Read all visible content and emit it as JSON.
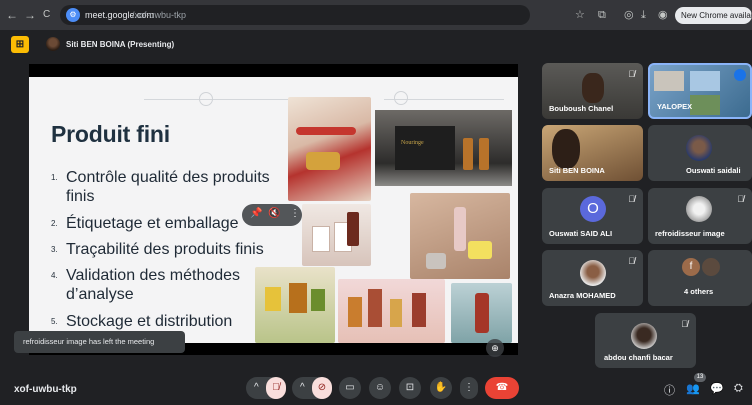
{
  "browser": {
    "back_icon": "←",
    "forward_icon": "→",
    "reload_icon": "C",
    "url_host": "meet.google.com",
    "url_path": "/xof-uwbu-tkp",
    "update_label": "New Chrome available"
  },
  "presenter": {
    "badge_icon": "present-icon",
    "badge_glyph": "⊞",
    "name": "Siti BEN BOINA (Presenting)"
  },
  "slide": {
    "title": "Produit fini",
    "bullets": [
      {
        "num": "1.",
        "text": "Contrôle qualité des produits",
        "cont": "finis"
      },
      {
        "num": "2.",
        "text": "Étiquetage et emballage"
      },
      {
        "num": "3.",
        "text": "Traçabilité des produits finis"
      },
      {
        "num": "4.",
        "text": "Validation des méthodes",
        "cont": "d’analyse"
      },
      {
        "num": "5.",
        "text": "Stockage et distribution"
      }
    ],
    "product_box_label": "Nouringe"
  },
  "participants": [
    {
      "name": "Bouboush Chanel",
      "muted": true
    },
    {
      "name": "YALOPEX",
      "muted": false
    },
    {
      "name": "Siti BEN BOINA",
      "muted": false
    },
    {
      "name": "Ouswati saidali",
      "muted": false
    },
    {
      "name": "Ouswati SAID ALI",
      "muted": true,
      "initial": "O"
    },
    {
      "name": "refroidisseur image",
      "muted": true
    },
    {
      "name": "Anazra MOHAMED",
      "muted": true
    },
    {
      "name": "4 others",
      "muted": false,
      "initial": "f"
    },
    {
      "name": "abdou chanfi bacar",
      "muted": true
    }
  ],
  "toast": {
    "text": "refroidisseur image has left the meeting"
  },
  "footer": {
    "meeting_code": "xof-uwbu-tkp",
    "people_count": "13"
  },
  "colors": {
    "background": "#202124",
    "tile": "#3c4043",
    "end_call": "#ea4335",
    "mic_off": "#f9dedc",
    "present_badge": "#fbbc04",
    "avatar_blue": "#5b69dc"
  }
}
